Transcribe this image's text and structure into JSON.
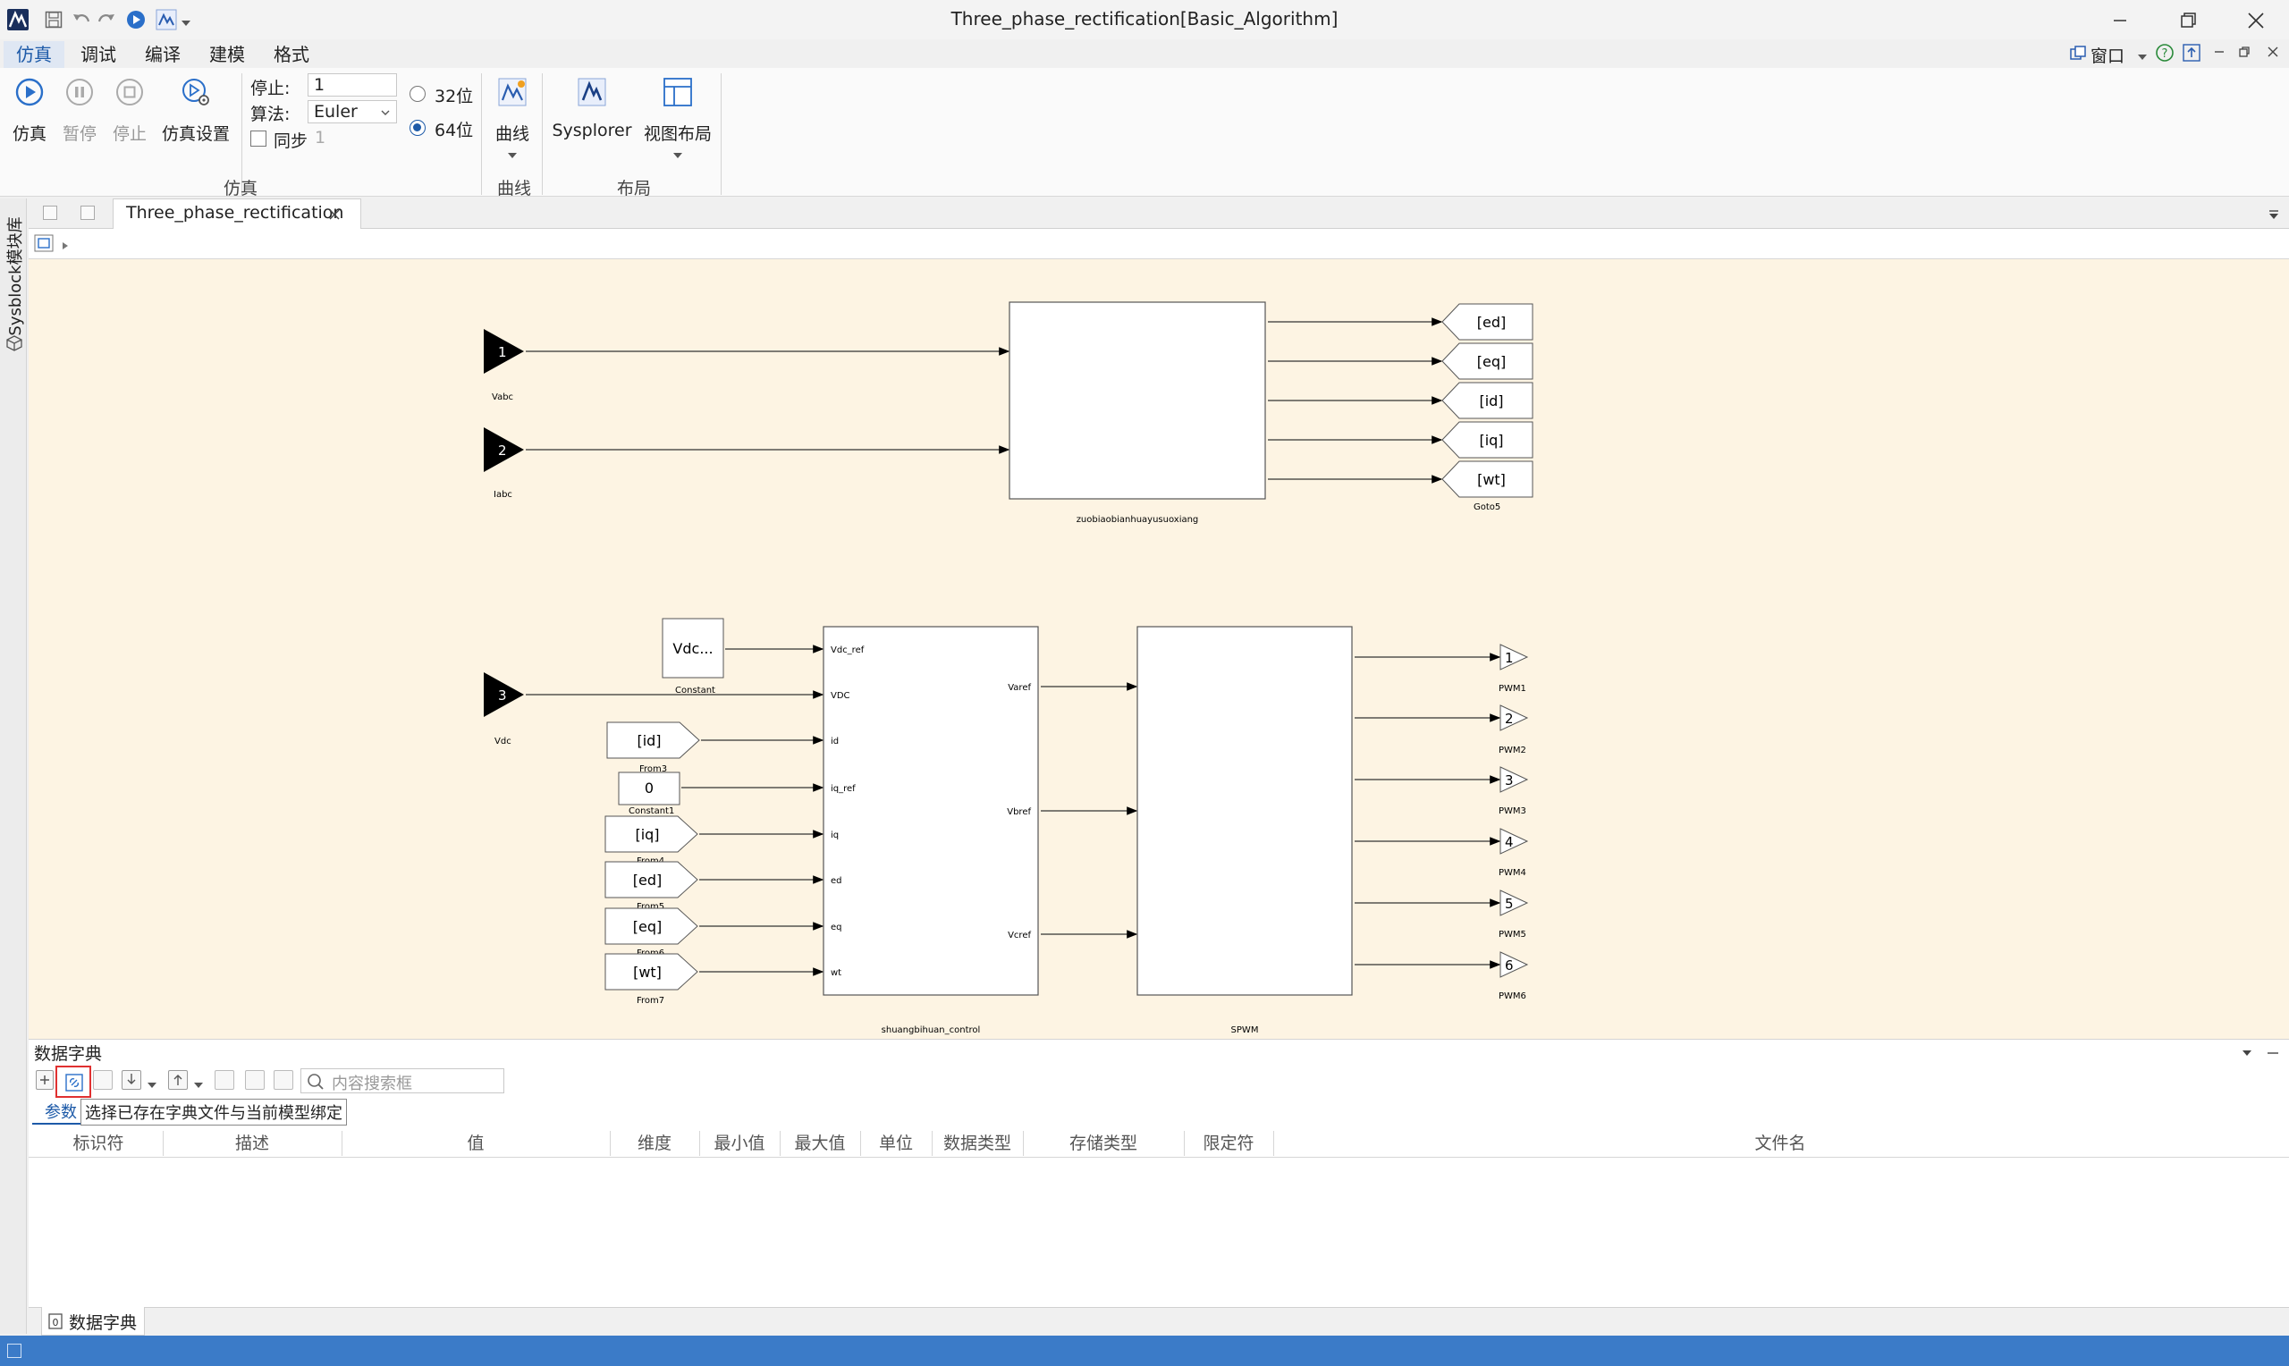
{
  "window": {
    "title": "Three_phase_rectification[Basic_Algorithm]"
  },
  "menu": {
    "items": [
      "仿真",
      "调试",
      "编译",
      "建模",
      "格式"
    ],
    "right": {
      "window_label": "窗口"
    }
  },
  "ribbon": {
    "sim_buttons": {
      "simulate": "仿真",
      "pause": "暂停",
      "stop": "停止",
      "settings": "仿真设置"
    },
    "stop_label": "停止:",
    "stop_value": "1",
    "algo_label": "算法:",
    "algo_value": "Euler",
    "sync_label": "同步",
    "sync_value": "1",
    "bit32": "32位",
    "bit64": "64位",
    "curve_button": "曲线",
    "sysplorer_button": "Sysplorer",
    "layout_button": "视图布局",
    "groups": {
      "sim": "仿真",
      "curve": "曲线",
      "layout": "布局"
    }
  },
  "side_panel": {
    "label": "Sysblock模块库"
  },
  "tabs": {
    "model_tab": "Three_phase_rectification"
  },
  "diagram": {
    "inports": [
      {
        "num": "1",
        "label": "Vabc"
      },
      {
        "num": "2",
        "label": "Iabc"
      },
      {
        "num": "3",
        "label": "Vdc"
      }
    ],
    "subsystem1": {
      "label": "zuobiaobianhuayusuoxiang"
    },
    "gotos": [
      "[ed]",
      "[eq]",
      "[id]",
      "[iq]",
      "[wt]"
    ],
    "goto_label": "Goto5",
    "constant": {
      "value": "Vdc...",
      "label": "Constant"
    },
    "constant1": {
      "value": "0",
      "label": "Constant1"
    },
    "froms": [
      {
        "tag": "[id]",
        "label": "From3"
      },
      {
        "tag": "[iq]",
        "label": "From4"
      },
      {
        "tag": "[ed]",
        "label": "From5"
      },
      {
        "tag": "[eq]",
        "label": "From6"
      },
      {
        "tag": "[wt]",
        "label": "From7"
      }
    ],
    "control": {
      "label": "shuangbihuan_control",
      "inputs": [
        "Vdc_ref",
        "VDC",
        "id",
        "iq_ref",
        "iq",
        "ed",
        "eq",
        "wt"
      ],
      "outputs": [
        "Varef",
        "Vbref",
        "Vcref"
      ]
    },
    "spwm": {
      "label": "SPWM"
    },
    "outports": [
      {
        "num": "1",
        "label": "PWM1"
      },
      {
        "num": "2",
        "label": "PWM2"
      },
      {
        "num": "3",
        "label": "PWM3"
      },
      {
        "num": "4",
        "label": "PWM4"
      },
      {
        "num": "5",
        "label": "PWM5"
      },
      {
        "num": "6",
        "label": "PWM6"
      }
    ]
  },
  "dict": {
    "title": "数据字典",
    "search_placeholder": "内容搜索框",
    "tab_param": "参数",
    "tooltip": "选择已存在字典文件与当前模型绑定",
    "columns": [
      "标识符",
      "描述",
      "值",
      "维度",
      "最小值",
      "最大值",
      "单位",
      "数据类型",
      "存储类型",
      "限定符",
      "文件名"
    ],
    "bottom_tab": "数据字典"
  },
  "colors": {
    "canvas": "#fdf4e3",
    "accent": "#1d5aa8",
    "status_bar": "#3b7bc8",
    "tooltip_border": "#e03030"
  }
}
